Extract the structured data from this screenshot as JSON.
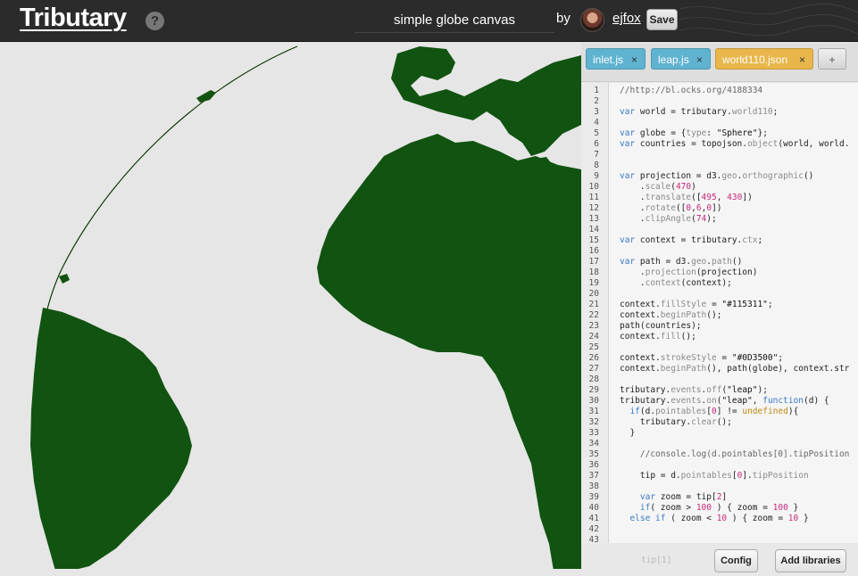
{
  "header": {
    "logo": "Tributary",
    "help": "?",
    "title_value": "simple globe canvas",
    "by": "by",
    "username": "ejfox",
    "save_label": "Save"
  },
  "tabs": [
    {
      "label": "inlet.js",
      "close": "×"
    },
    {
      "label": "leap.js",
      "close": "×"
    },
    {
      "label": "world110.json",
      "close": "×"
    },
    {
      "label": "+"
    }
  ],
  "code": {
    "line_numbers": [
      "1",
      "2",
      "3",
      "4",
      "5",
      "6",
      "7",
      "8",
      "9",
      "10",
      "11",
      "12",
      "13",
      "14",
      "15",
      "16",
      "17",
      "18",
      "19",
      "20",
      "21",
      "22",
      "23",
      "24",
      "25",
      "26",
      "27",
      "28",
      "29",
      "30",
      "31",
      "32",
      "33",
      "34",
      "35",
      "36",
      "37",
      "38",
      "39",
      "40",
      "41",
      "42",
      "43"
    ],
    "ghost_line": "tip[1]"
  },
  "footer": {
    "config_label": "Config",
    "libraries_label": "Add libraries"
  },
  "colors": {
    "land": "#115311",
    "stroke": "#0D3500",
    "ocean": "#e6e6e6"
  }
}
